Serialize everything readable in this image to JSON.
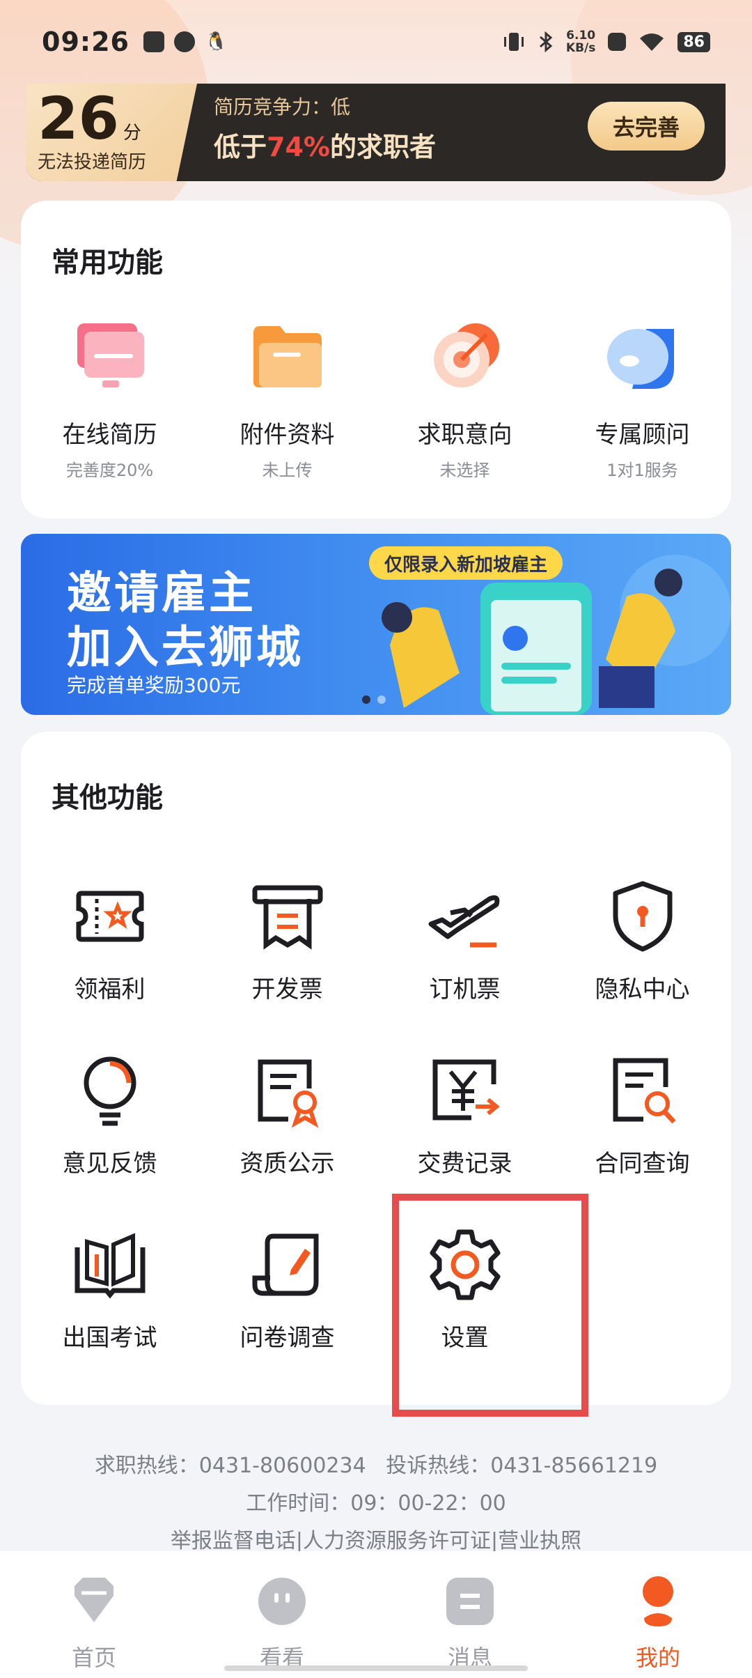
{
  "status_bar": {
    "time": "09:26",
    "net_speed_value": "6.10",
    "net_speed_unit": "KB/s",
    "battery": "86"
  },
  "score_banner": {
    "score": "26",
    "unit": "分",
    "warning": "无法投递简历",
    "label": "简历竞争力：低",
    "text_prefix": "低于",
    "percent": "74%",
    "text_suffix": "的求职者",
    "button": "去完善"
  },
  "common": {
    "title": "常用功能",
    "items": [
      {
        "label": "在线简历",
        "sub": "完善度20%",
        "icon": "resume-icon"
      },
      {
        "label": "附件资料",
        "sub": "未上传",
        "icon": "folder-icon"
      },
      {
        "label": "求职意向",
        "sub": "未选择",
        "icon": "target-icon"
      },
      {
        "label": "专属顾问",
        "sub": "1对1服务",
        "icon": "chat-bubble-icon"
      }
    ]
  },
  "promo": {
    "line1": "邀请雇主",
    "line2": "加入去狮城",
    "sub": "完成首单奖励300元",
    "tag": "仅限录入新加坡雇主"
  },
  "other": {
    "title": "其他功能",
    "items": [
      {
        "label": "领福利",
        "icon": "ticket-icon"
      },
      {
        "label": "开发票",
        "icon": "invoice-icon"
      },
      {
        "label": "订机票",
        "icon": "airplane-icon"
      },
      {
        "label": "隐私中心",
        "icon": "shield-icon"
      },
      {
        "label": "意见反馈",
        "icon": "lightbulb-icon"
      },
      {
        "label": "资质公示",
        "icon": "certificate-icon"
      },
      {
        "label": "交费记录",
        "icon": "payment-record-icon"
      },
      {
        "label": "合同查询",
        "icon": "contract-search-icon"
      },
      {
        "label": "出国考试",
        "icon": "book-icon"
      },
      {
        "label": "问卷调查",
        "icon": "survey-icon"
      },
      {
        "label": "设置",
        "icon": "gear-icon"
      }
    ]
  },
  "footer": {
    "hotline": "求职热线：0431-80600234",
    "complaint": "投诉热线：0431-85661219",
    "hours": "工作时间：09：00-22：00",
    "links": [
      "举报监督电话",
      "人力资源服务许可证",
      "营业执照"
    ]
  },
  "nav": [
    {
      "label": "首页",
      "icon": "home-icon"
    },
    {
      "label": "看看",
      "icon": "face-icon"
    },
    {
      "label": "消息",
      "icon": "message-icon"
    },
    {
      "label": "我的",
      "icon": "profile-icon"
    }
  ],
  "colors": {
    "accent": "#f25a22",
    "highlight": "#e74c4c",
    "percent_red": "#ef4b40"
  }
}
